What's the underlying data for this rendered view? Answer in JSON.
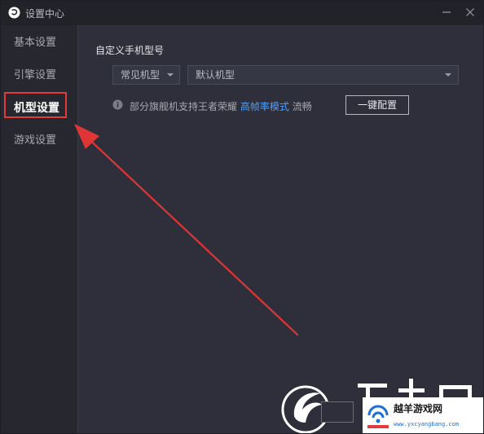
{
  "window": {
    "title": "设置中心",
    "controls": [
      "minimize-icon",
      "close-icon"
    ]
  },
  "sidebar": {
    "items": [
      {
        "label": "基本设置",
        "active": false
      },
      {
        "label": "引擎设置",
        "active": false
      },
      {
        "label": "机型设置",
        "active": true
      },
      {
        "label": "游戏设置",
        "active": false
      }
    ]
  },
  "main": {
    "section_title": "自定义手机型号",
    "type_select": {
      "value": "常见机型"
    },
    "model_select": {
      "value": "默认机型"
    },
    "info": {
      "icon": "info-icon",
      "text_before": "部分旗舰机支持王者荣耀",
      "link": "高帧率模式",
      "text_after": "流畅"
    },
    "config_button": "一键配置"
  },
  "watermark": {
    "title": "越羊游戏网",
    "url": "www.yxcyangbang.com"
  },
  "colors": {
    "accent": "#4d9fff",
    "highlight": "#e43a3a",
    "background": "#2e2f3a",
    "sidebar": "#26272f"
  }
}
